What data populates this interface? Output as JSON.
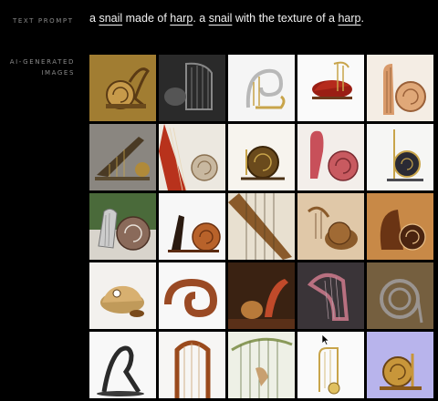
{
  "labels": {
    "text_prompt": "TEXT PROMPT",
    "ai_images_line1": "AI-GENERATED",
    "ai_images_line2": "IMAGES"
  },
  "prompt": {
    "p1": "a ",
    "w1": "snail",
    "p2": " made of ",
    "w2": "harp",
    "p3": ". a ",
    "w3": "snail",
    "p4": " with the texture of a ",
    "w4": "harp",
    "p5": "."
  },
  "grid": {
    "rows": 5,
    "columns": 5,
    "tile_count": 25
  },
  "colors": {
    "background": "#000000",
    "label": "#8a8a8a",
    "prompt_text": "#f2f2f2"
  }
}
